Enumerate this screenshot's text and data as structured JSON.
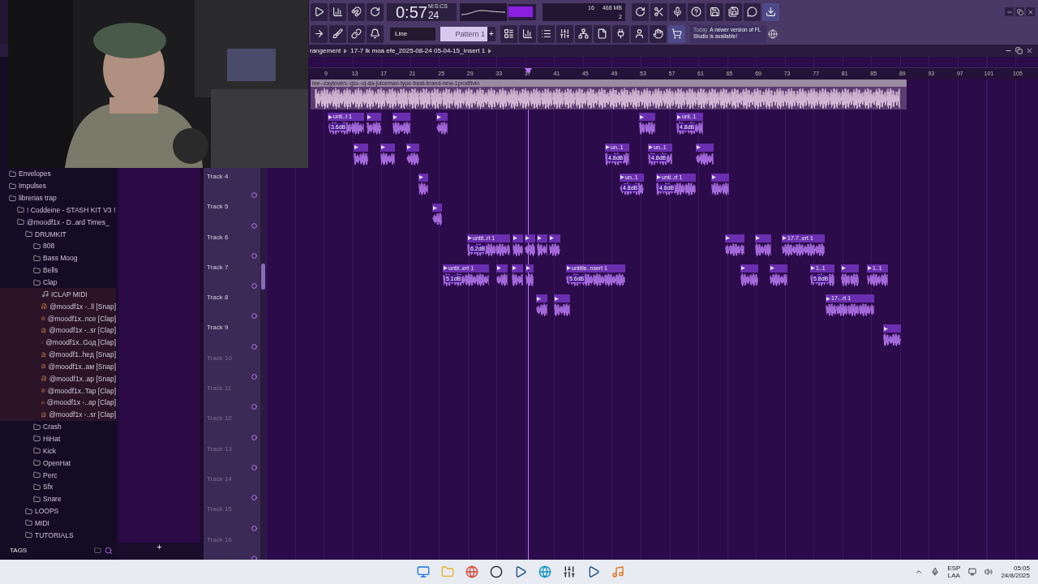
{
  "toolbar": {
    "time": {
      "main": "0:57",
      "sub": "24",
      "unit": "M:S:CS"
    },
    "cpu": {
      "value": "16",
      "memory": "468 MB",
      "polyphony": "2"
    },
    "snap": {
      "value": "Line"
    },
    "pattern": {
      "name": "Pattern 1",
      "add": "+"
    },
    "news": {
      "label": "Today",
      "message": "A newer version of FL Studio is available!"
    }
  },
  "breadcrumb": [
    "rangement",
    "17-7 lk moa efe_2025-08-24 05-04-15_Insert 1"
  ],
  "browser": {
    "items": [
      {
        "label": "Envelopes",
        "kind": "folder"
      },
      {
        "label": "Impulses",
        "kind": "folder"
      },
      {
        "label": "librerias trap",
        "kind": "folder",
        "children": [
          {
            "label": "! Coddeine - STASH KIT V3 !",
            "kind": "folder"
          },
          {
            "label": "@moodf1x - D..ard Times_",
            "kind": "folder",
            "children": [
              {
                "label": "DRUMKIT",
                "kind": "folder",
                "children": [
                  {
                    "label": "808",
                    "kind": "folder"
                  },
                  {
                    "label": "Bass Moog",
                    "kind": "folder"
                  },
                  {
                    "label": "Bells",
                    "kind": "folder"
                  },
                  {
                    "label": "Clap",
                    "kind": "folder",
                    "children": [
                      {
                        "label": "ICLAP MIDI",
                        "kind": "midi"
                      },
                      {
                        "label": "@moodf1x -..ll [Snap]",
                        "kind": "sample"
                      },
                      {
                        "label": "@moodf1x..nce [Clap]",
                        "kind": "sample"
                      },
                      {
                        "label": "@moodf1x -..sr [Clap]",
                        "kind": "sample"
                      },
                      {
                        "label": "@moodf1x..Goд [Clap]",
                        "kind": "sample"
                      },
                      {
                        "label": "@moodf1..heд [Snap]",
                        "kind": "sample"
                      },
                      {
                        "label": "@moodf1x..aм [Snap]",
                        "kind": "sample"
                      },
                      {
                        "label": "@moodf1x..ap [Snap]",
                        "kind": "sample"
                      },
                      {
                        "label": "@moodf1x..Tap [Clap]",
                        "kind": "sample"
                      },
                      {
                        "label": "@moodf1x -..ap [Clap]",
                        "kind": "sample"
                      },
                      {
                        "label": "@moodf1x -..sr [Clap]",
                        "kind": "sample"
                      }
                    ]
                  },
                  {
                    "label": "Crash",
                    "kind": "folder"
                  },
                  {
                    "label": "HiHat",
                    "kind": "folder"
                  },
                  {
                    "label": "Kick",
                    "kind": "folder"
                  },
                  {
                    "label": "OpenHat",
                    "kind": "folder"
                  },
                  {
                    "label": "Perc",
                    "kind": "folder"
                  },
                  {
                    "label": "Sfx",
                    "kind": "folder"
                  },
                  {
                    "label": "Snare",
                    "kind": "folder"
                  }
                ]
              },
              {
                "label": "LOOPS",
                "kind": "folder"
              },
              {
                "label": "MIDI",
                "kind": "folder"
              },
              {
                "label": "TUTORIALS",
                "kind": "folder"
              }
            ]
          }
        ]
      }
    ],
    "tags_label": "TAGS"
  },
  "pane": {
    "add": "+"
  },
  "track_headers": [
    {
      "name": "Track 4",
      "active": true
    },
    {
      "name": "Track 5",
      "active": true
    },
    {
      "name": "Track 6",
      "active": true
    },
    {
      "name": "Track 7",
      "active": true
    },
    {
      "name": "Track 8",
      "active": true
    },
    {
      "name": "Track 9",
      "active": true
    },
    {
      "name": "Track 10",
      "active": false
    },
    {
      "name": "Track 11",
      "active": false
    },
    {
      "name": "Track 12",
      "active": false
    },
    {
      "name": "Track 13",
      "active": false
    },
    {
      "name": "Track 14",
      "active": false
    },
    {
      "name": "Track 15",
      "active": false
    },
    {
      "name": "Track 16",
      "active": false
    }
  ],
  "playlist": {
    "ruler": [
      "9",
      "13",
      "17",
      "21",
      "25",
      "29",
      "33",
      "37",
      "41",
      "45",
      "49",
      "53",
      "57",
      "61",
      "65",
      "69",
      "73",
      "77",
      "81",
      "85",
      "89",
      "93",
      "97",
      "101",
      "105"
    ],
    "audio_clip": {
      "title": "ine--zaytoven--glo--oj-da-juiceman-type-beat-brand-new-1prodfivin"
    },
    "tracks": [
      {
        "clips": [
          {
            "kind": "audio",
            "label": "unti..t 1",
            "gain": "3.6dB"
          },
          {
            "kind": "audio"
          },
          {
            "kind": "audio"
          },
          {
            "kind": "audio"
          },
          {
            "kind": "audio"
          },
          {
            "kind": "audio",
            "label": "unt..1",
            "gain": "4.8dB"
          }
        ]
      },
      {
        "clips": [
          {
            "kind": "audio"
          },
          {
            "kind": "audio"
          },
          {
            "kind": "audio"
          },
          {
            "kind": "audio",
            "label": "un..1",
            "gain": "4.8dB"
          },
          {
            "kind": "audio",
            "label": "un..1",
            "gain": "4.8dB"
          },
          {
            "kind": "audio"
          }
        ]
      },
      {
        "clips": [
          {
            "kind": "audio"
          },
          {
            "kind": "audio",
            "label": "un..1",
            "gain": "4.8dB"
          },
          {
            "kind": "audio",
            "label": "unti..rt 1",
            "gain": "4.8dB"
          },
          {
            "kind": "audio"
          }
        ]
      },
      {
        "clips": [
          {
            "kind": "audio"
          }
        ]
      },
      {
        "clips": [
          {
            "kind": "audio",
            "label": "untit..rt 1",
            "gain": "6.2dB"
          },
          {
            "kind": "audio"
          },
          {
            "kind": "audio"
          },
          {
            "kind": "audio"
          },
          {
            "kind": "audio"
          },
          {
            "kind": "audio"
          },
          {
            "kind": "audio"
          },
          {
            "kind": "audio",
            "label": "17-7..ert 1"
          }
        ]
      },
      {
        "clips": [
          {
            "kind": "audio",
            "label": "untit..ert 1",
            "gain": "5.1dB"
          },
          {
            "kind": "audio"
          },
          {
            "kind": "audio"
          },
          {
            "kind": "audio"
          },
          {
            "kind": "audio",
            "label": "untitle..nsert 1",
            "gain": "5.6dB"
          },
          {
            "kind": "audio"
          },
          {
            "kind": "audio"
          },
          {
            "kind": "audio",
            "label": "1..1",
            "gain": "5.8dB"
          },
          {
            "kind": "audio"
          },
          {
            "kind": "audio",
            "label": "1..1"
          }
        ]
      },
      {
        "clips": [
          {
            "kind": "audio"
          },
          {
            "kind": "audio"
          },
          {
            "kind": "audio",
            "label": "17-..rt 1"
          }
        ]
      },
      {
        "clips": [
          {
            "kind": "audio"
          }
        ]
      }
    ]
  },
  "webcam": {
    "kind": "picture"
  },
  "taskbar": {
    "language": "ESP",
    "region": "LAA",
    "time": "05:05",
    "date": "24/8/2025"
  }
}
